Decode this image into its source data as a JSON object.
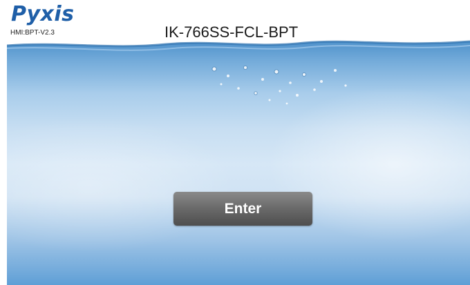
{
  "header": {
    "brand": "Pyxis",
    "version": "HMI:BPT-V2.3",
    "model": "IK-766SS-FCL-BPT"
  },
  "main": {
    "enter_label": "Enter"
  },
  "colors": {
    "brand": "#1f5fa8",
    "button": "#6a6a6a",
    "water": "#6fa8d8"
  }
}
